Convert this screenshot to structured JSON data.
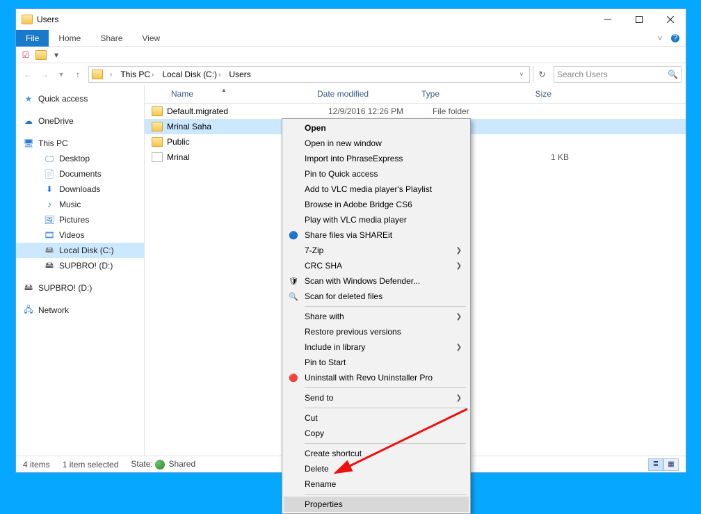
{
  "window": {
    "title": "Users"
  },
  "ribbon": {
    "file": "File",
    "tabs": [
      "Home",
      "Share",
      "View"
    ]
  },
  "breadcrumb": [
    "This PC",
    "Local Disk (C:)",
    "Users"
  ],
  "search_placeholder": "Search Users",
  "columns": {
    "name": "Name",
    "date": "Date modified",
    "type": "Type",
    "size": "Size"
  },
  "files": [
    {
      "icon": "folder",
      "name": "Default.migrated",
      "date": "12/9/2016 12:26 PM",
      "type": "File folder",
      "size": "",
      "selected": false
    },
    {
      "icon": "folder",
      "name": "Mrinal Saha",
      "date": "",
      "type": "",
      "size": "",
      "selected": true
    },
    {
      "icon": "folder",
      "name": "Public",
      "date": "",
      "type": "",
      "size": "",
      "selected": false
    },
    {
      "icon": "file",
      "name": "Mrinal",
      "date": "",
      "type": "",
      "size": "1 KB",
      "selected": false
    }
  ],
  "tree": {
    "quick_access": "Quick access",
    "onedrive": "OneDrive",
    "this_pc": "This PC",
    "children": [
      "Desktop",
      "Documents",
      "Downloads",
      "Music",
      "Pictures",
      "Videos",
      "Local Disk (C:)",
      "SUPBRO! (D:)"
    ],
    "extra_drive": "SUPBRO! (D:)",
    "network": "Network"
  },
  "statusbar": {
    "items": "4 items",
    "selected": "1 item selected",
    "state_label": "State:",
    "state_value": "Shared"
  },
  "context_menu": [
    {
      "type": "item",
      "label": "Open",
      "bold": true
    },
    {
      "type": "item",
      "label": "Open in new window"
    },
    {
      "type": "item",
      "label": "Import into PhraseExpress"
    },
    {
      "type": "item",
      "label": "Pin to Quick access"
    },
    {
      "type": "item",
      "label": "Add to VLC media player's Playlist"
    },
    {
      "type": "item",
      "label": "Browse in Adobe Bridge CS6"
    },
    {
      "type": "item",
      "label": "Play with VLC media player"
    },
    {
      "type": "item",
      "label": "Share files via SHAREit",
      "icon": "shareit"
    },
    {
      "type": "item",
      "label": "7-Zip",
      "submenu": true
    },
    {
      "type": "item",
      "label": "CRC SHA",
      "submenu": true
    },
    {
      "type": "item",
      "label": "Scan with Windows Defender...",
      "icon": "defender"
    },
    {
      "type": "item",
      "label": "Scan for deleted files",
      "icon": "scan"
    },
    {
      "type": "sep"
    },
    {
      "type": "item",
      "label": "Share with",
      "submenu": true
    },
    {
      "type": "item",
      "label": "Restore previous versions"
    },
    {
      "type": "item",
      "label": "Include in library",
      "submenu": true
    },
    {
      "type": "item",
      "label": "Pin to Start"
    },
    {
      "type": "item",
      "label": "Uninstall with Revo Uninstaller Pro",
      "icon": "revo"
    },
    {
      "type": "sep"
    },
    {
      "type": "item",
      "label": "Send to",
      "submenu": true
    },
    {
      "type": "sep"
    },
    {
      "type": "item",
      "label": "Cut"
    },
    {
      "type": "item",
      "label": "Copy"
    },
    {
      "type": "sep"
    },
    {
      "type": "item",
      "label": "Create shortcut"
    },
    {
      "type": "item",
      "label": "Delete"
    },
    {
      "type": "item",
      "label": "Rename"
    },
    {
      "type": "sep"
    },
    {
      "type": "item",
      "label": "Properties",
      "highlight": true
    }
  ],
  "icons": {
    "quick_access": "★",
    "onedrive": "☁",
    "this_pc": "🖥",
    "desktop": "🖵",
    "documents": "📄",
    "downloads": "⬇",
    "music": "♪",
    "pictures": "🖼",
    "videos": "🎞",
    "drive": "🖴",
    "network": "🖧"
  }
}
